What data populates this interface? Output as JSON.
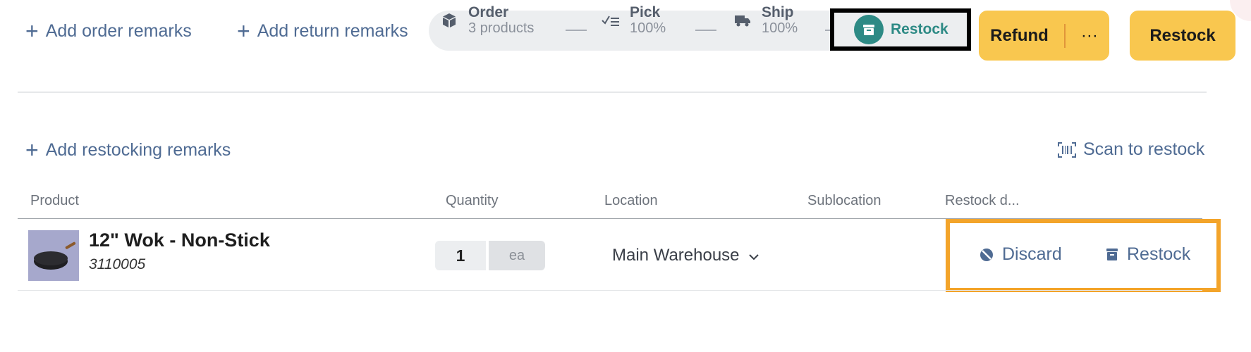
{
  "remarks": {
    "order": "Add order remarks",
    "return": "Add return remarks",
    "restocking": "Add restocking remarks"
  },
  "tracker": {
    "order": {
      "label": "Order",
      "sub": "3 products",
      "icon": "box-icon"
    },
    "pick": {
      "label": "Pick",
      "sub": "100%",
      "icon": "checklist-icon"
    },
    "ship": {
      "label": "Ship",
      "sub": "100%",
      "icon": "truck-icon"
    },
    "restock": {
      "label": "Restock",
      "icon": "archive-icon"
    }
  },
  "buttons": {
    "refund": "Refund",
    "more": "···",
    "restock": "Restock"
  },
  "scan": {
    "label": "Scan to restock",
    "icon": "barcode-icon"
  },
  "table": {
    "headers": {
      "product": "Product",
      "quantity": "Quantity",
      "location": "Location",
      "sublocation": "Sublocation",
      "restock_decision": "Restock d..."
    },
    "rows": [
      {
        "name": "12\" Wok - Non-Stick",
        "sku": "3110005",
        "quantity": "1",
        "unit": "ea",
        "location": "Main Warehouse",
        "discard": "Discard",
        "restock": "Restock"
      }
    ]
  },
  "colors": {
    "accent_yellow": "#f9c74f",
    "active_teal": "#2d8a85",
    "link_blue": "#4f6b93",
    "highlight_orange": "#f3a42a"
  }
}
